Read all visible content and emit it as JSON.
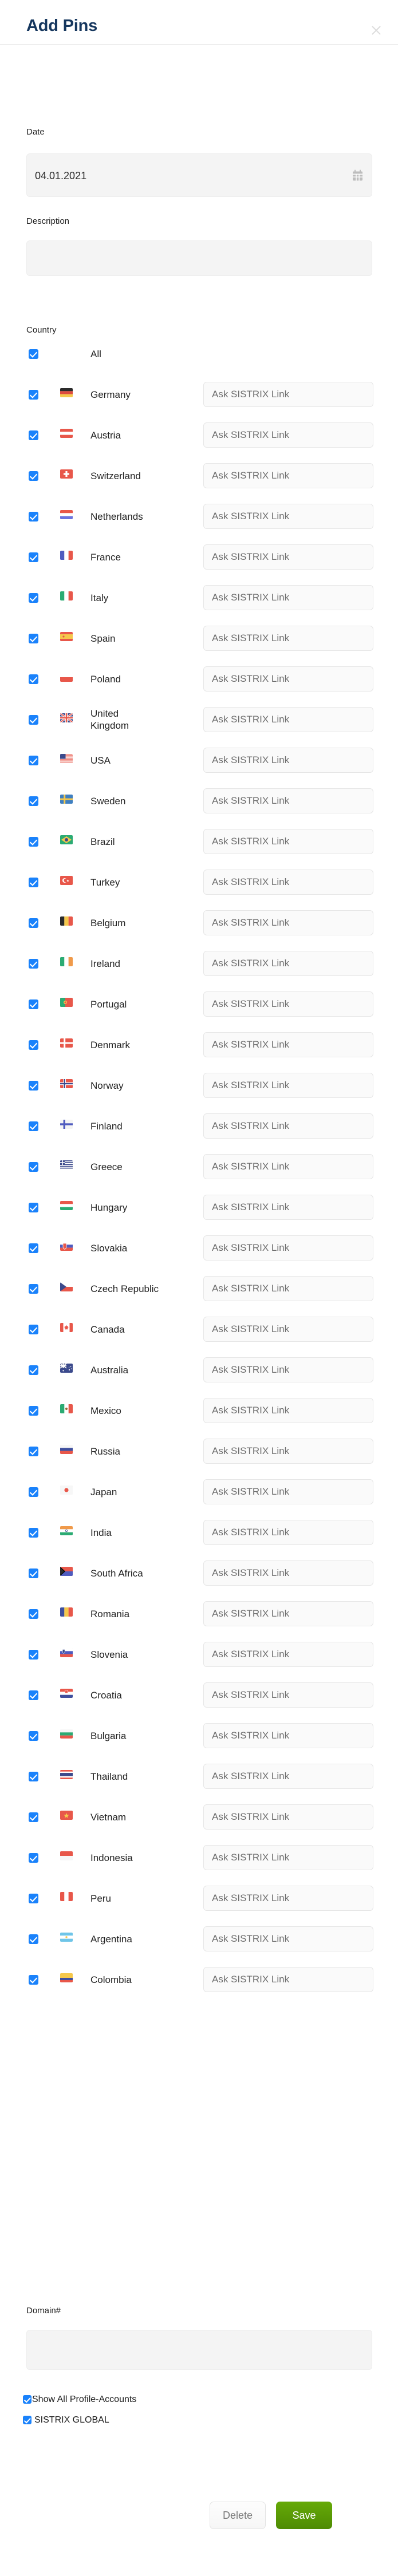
{
  "header": {
    "title": "Add Pins",
    "close_icon": "close-icon"
  },
  "form": {
    "date": {
      "label": "Date",
      "value": "04.01.2021",
      "icon": "calendar-icon"
    },
    "description": {
      "label": "Description",
      "value": "",
      "placeholder": ""
    },
    "country": {
      "label": "Country"
    },
    "domain": {
      "label": "Domain#",
      "value": "",
      "placeholder": ""
    }
  },
  "sistrix_link_placeholder": "Ask SISTRIX Link",
  "countries": [
    {
      "label": "All",
      "checked": true,
      "flag": null,
      "has_input": false
    },
    {
      "label": "Germany",
      "checked": true,
      "flag": "de",
      "has_input": true
    },
    {
      "label": "Austria",
      "checked": true,
      "flag": "at",
      "has_input": true
    },
    {
      "label": "Switzerland",
      "checked": true,
      "flag": "ch",
      "has_input": true
    },
    {
      "label": "Netherlands",
      "checked": true,
      "flag": "nl",
      "has_input": true
    },
    {
      "label": "France",
      "checked": true,
      "flag": "fr",
      "has_input": true
    },
    {
      "label": "Italy",
      "checked": true,
      "flag": "it",
      "has_input": true
    },
    {
      "label": "Spain",
      "checked": true,
      "flag": "es",
      "has_input": true
    },
    {
      "label": "Poland",
      "checked": true,
      "flag": "pl",
      "has_input": true
    },
    {
      "label": "United Kingdom",
      "checked": true,
      "flag": "gb",
      "has_input": true
    },
    {
      "label": "USA",
      "checked": true,
      "flag": "us",
      "has_input": true
    },
    {
      "label": "Sweden",
      "checked": true,
      "flag": "se",
      "has_input": true
    },
    {
      "label": "Brazil",
      "checked": true,
      "flag": "br",
      "has_input": true
    },
    {
      "label": "Turkey",
      "checked": true,
      "flag": "tr",
      "has_input": true
    },
    {
      "label": "Belgium",
      "checked": true,
      "flag": "be",
      "has_input": true
    },
    {
      "label": "Ireland",
      "checked": true,
      "flag": "ie",
      "has_input": true
    },
    {
      "label": "Portugal",
      "checked": true,
      "flag": "pt",
      "has_input": true
    },
    {
      "label": "Denmark",
      "checked": true,
      "flag": "dk",
      "has_input": true
    },
    {
      "label": "Norway",
      "checked": true,
      "flag": "no",
      "has_input": true
    },
    {
      "label": "Finland",
      "checked": true,
      "flag": "fi",
      "has_input": true
    },
    {
      "label": "Greece",
      "checked": true,
      "flag": "gr",
      "has_input": true
    },
    {
      "label": "Hungary",
      "checked": true,
      "flag": "hu",
      "has_input": true
    },
    {
      "label": "Slovakia",
      "checked": true,
      "flag": "sk",
      "has_input": true
    },
    {
      "label": "Czech Republic",
      "checked": true,
      "flag": "cz",
      "has_input": true
    },
    {
      "label": "Canada",
      "checked": true,
      "flag": "ca",
      "has_input": true
    },
    {
      "label": "Australia",
      "checked": true,
      "flag": "au",
      "has_input": true
    },
    {
      "label": "Mexico",
      "checked": true,
      "flag": "mx",
      "has_input": true
    },
    {
      "label": "Russia",
      "checked": true,
      "flag": "ru",
      "has_input": true
    },
    {
      "label": "Japan",
      "checked": true,
      "flag": "jp",
      "has_input": true
    },
    {
      "label": "India",
      "checked": true,
      "flag": "in",
      "has_input": true
    },
    {
      "label": "South Africa",
      "checked": true,
      "flag": "za",
      "has_input": true
    },
    {
      "label": "Romania",
      "checked": true,
      "flag": "ro",
      "has_input": true
    },
    {
      "label": "Slovenia",
      "checked": true,
      "flag": "si",
      "has_input": true
    },
    {
      "label": "Croatia",
      "checked": true,
      "flag": "hr",
      "has_input": true
    },
    {
      "label": "Bulgaria",
      "checked": true,
      "flag": "bg",
      "has_input": true
    },
    {
      "label": "Thailand",
      "checked": true,
      "flag": "th",
      "has_input": true
    },
    {
      "label": "Vietnam",
      "checked": true,
      "flag": "vn",
      "has_input": true
    },
    {
      "label": "Indonesia",
      "checked": true,
      "flag": "id",
      "has_input": true
    },
    {
      "label": "Peru",
      "checked": true,
      "flag": "pe",
      "has_input": true
    },
    {
      "label": "Argentina",
      "checked": true,
      "flag": "ar",
      "has_input": true
    },
    {
      "label": "Colombia",
      "checked": true,
      "flag": "co",
      "has_input": true
    }
  ],
  "options": [
    {
      "label": "Show All Profile-Accounts",
      "checked": true
    },
    {
      "label": "SISTRIX GLOBAL",
      "checked": true
    }
  ],
  "footer": {
    "delete_label": "Delete",
    "save_label": "Save"
  },
  "colors": {
    "title": "#16375e",
    "checkbox": "#1a82fb",
    "save_button": "#4e8b03",
    "input_bg": "#f4f4f4"
  }
}
